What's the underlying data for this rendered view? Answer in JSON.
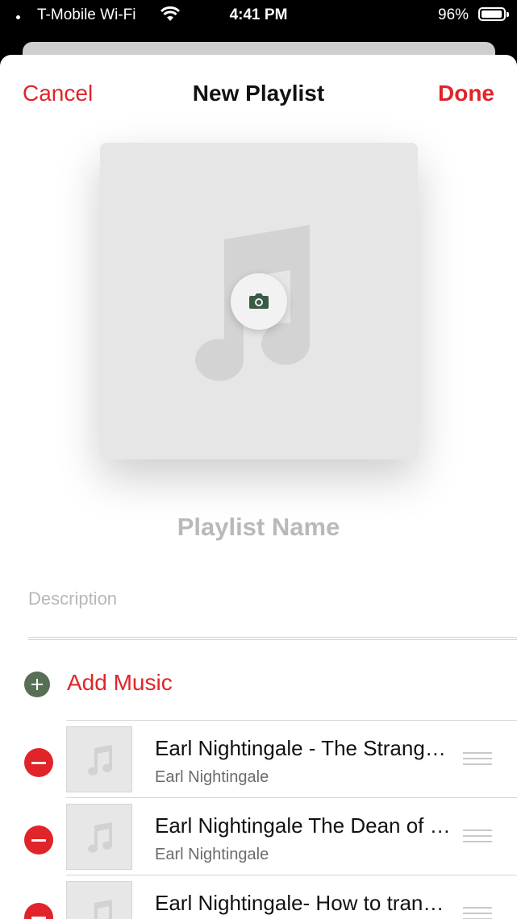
{
  "status_bar": {
    "carrier": "T-Mobile Wi-Fi",
    "time": "4:41 PM",
    "battery": "96%"
  },
  "nav": {
    "cancel": "Cancel",
    "title": "New Playlist",
    "done": "Done"
  },
  "artwork": {
    "placeholder_icon": "music-note-icon",
    "action_icon": "camera-icon"
  },
  "playlist_name_placeholder": "Playlist Name",
  "description_placeholder": "Description",
  "add_music": "Add Music",
  "tracks": [
    {
      "title": "Earl Nightingale - The Strangest Secret",
      "artist": "Earl Nightingale"
    },
    {
      "title": "Earl Nightingale The Dean of Personal Development",
      "artist": "Earl Nightingale"
    },
    {
      "title": "Earl Nightingale- How to transform your life",
      "artist": ""
    }
  ],
  "colors": {
    "accent": "#e0242a",
    "add": "#576f55"
  }
}
